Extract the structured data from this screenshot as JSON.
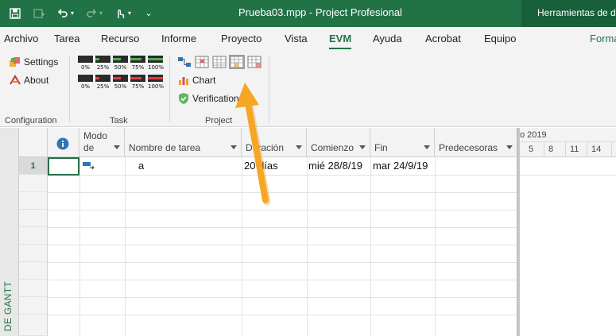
{
  "titlebar": {
    "title": "Prueba03.mpp  -  Project Profesional",
    "context_tools": "Herramientas de di"
  },
  "tabs": [
    {
      "label": "Archivo"
    },
    {
      "label": "Tarea"
    },
    {
      "label": "Recurso"
    },
    {
      "label": "Informe"
    },
    {
      "label": "Proyecto"
    },
    {
      "label": "Vista"
    },
    {
      "label": "EVM"
    },
    {
      "label": "Ayuda"
    },
    {
      "label": "Acrobat"
    },
    {
      "label": "Equipo"
    },
    {
      "label": "Forma"
    }
  ],
  "ribbon": {
    "configuration": {
      "label": "Configuration",
      "settings": "Settings",
      "about": "About"
    },
    "task": {
      "label": "Task",
      "row1": [
        "0%",
        "25%",
        "50%",
        "75%",
        "100%"
      ],
      "row2": [
        "0%",
        "25%",
        "50%",
        "75%",
        "100%"
      ]
    },
    "project": {
      "label": "Project",
      "chart": "Chart",
      "verification": "Verification"
    }
  },
  "grid": {
    "headers": {
      "info": "",
      "mode_line1": "Modo",
      "mode_line2": "de",
      "name": "Nombre de tarea",
      "duration": "Duración",
      "start": "Comienzo",
      "finish": "Fin",
      "predecessors": "Predecesoras"
    },
    "rows": [
      {
        "id": "1",
        "name": "a",
        "duration": "20 días",
        "start": "mié 28/8/19",
        "finish": "mar 24/9/19",
        "predecessors": ""
      }
    ]
  },
  "side_label": "DE GANTT",
  "timescale": {
    "top": "o 2019",
    "days": [
      "5",
      "8",
      "11",
      "14"
    ]
  },
  "colors": {
    "brand": "#217346",
    "arrow": "#f5a623"
  }
}
